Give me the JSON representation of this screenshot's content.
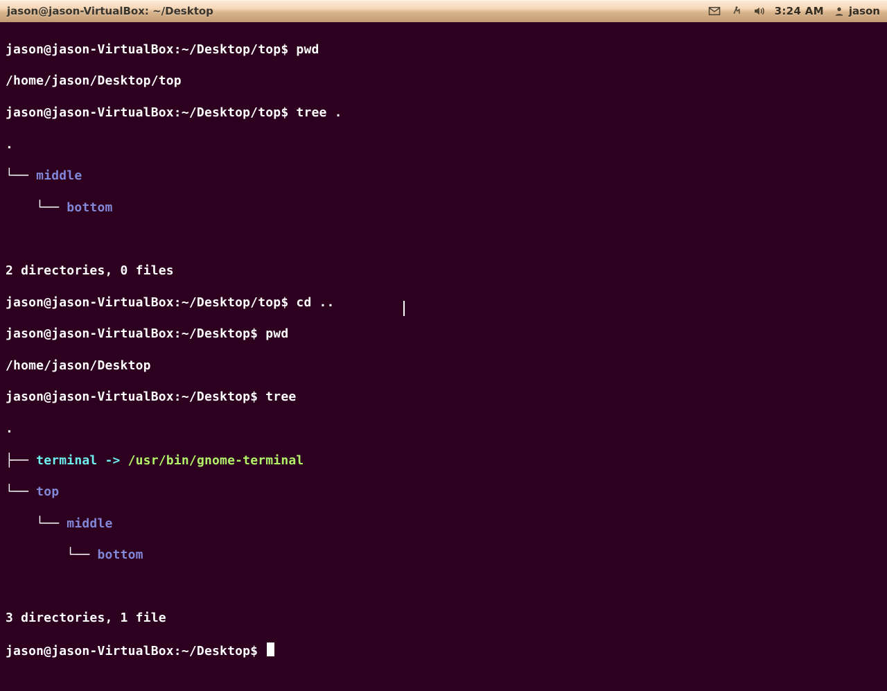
{
  "panel": {
    "window_title": "jason@jason-VirtualBox: ~/Desktop",
    "clock": "3:24 AM",
    "username": "jason"
  },
  "icons": {
    "mail": "mail-icon",
    "net": "network-icon",
    "vol": "volume-icon",
    "user": "user-icon"
  },
  "term": {
    "ps_top": "jason@jason-VirtualBox:~/Desktop/top$ ",
    "ps_desk": "jason@jason-VirtualBox:~/Desktop$ ",
    "cmd_pwd": "pwd",
    "out_pwd_top": "/home/jason/Desktop/top",
    "cmd_tree_dot": "tree .",
    "tree1_root": ".",
    "tree1_b1": "└── ",
    "tree1_middle": "middle",
    "tree1_b2": "    └── ",
    "tree1_bottom": "bottom",
    "tree1_summary": "2 directories, 0 files",
    "cmd_cdup": "cd ..",
    "out_pwd_desk": "/home/jason/Desktop",
    "cmd_tree": "tree",
    "tree2_root": ".",
    "tree2_b1": "├── ",
    "tree2_link": "terminal",
    "tree2_arrow": " -> ",
    "tree2_target": "/usr/bin/gnome-terminal",
    "tree2_b2": "└── ",
    "tree2_top": "top",
    "tree2_b3": "    └── ",
    "tree2_middle": "middle",
    "tree2_b4": "        └── ",
    "tree2_bottom": "bottom",
    "tree2_summary": "3 directories, 1 file"
  }
}
